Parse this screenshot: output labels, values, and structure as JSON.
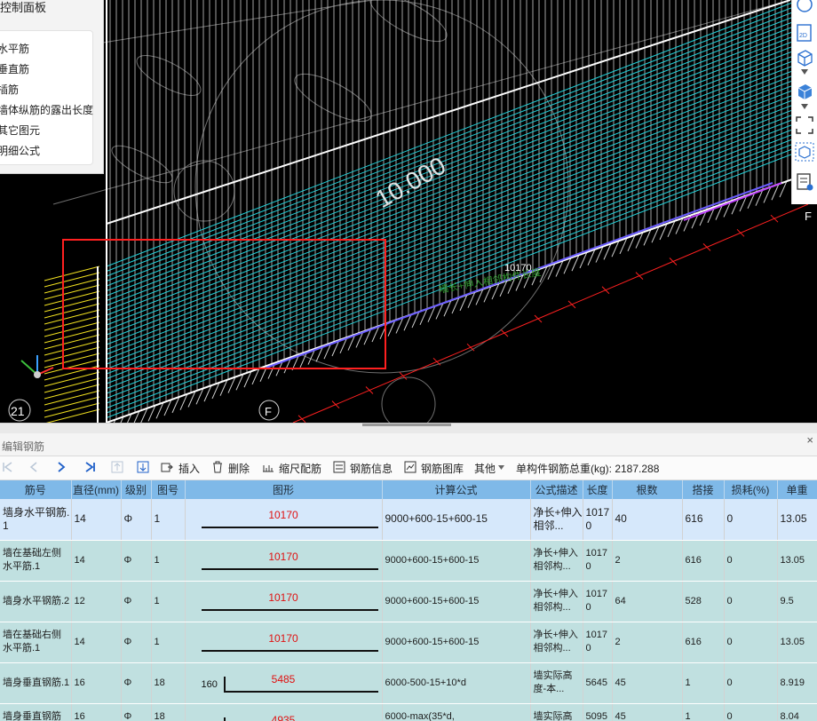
{
  "control_panel": {
    "title": "控制面板",
    "items": [
      "水平筋",
      "垂直筋",
      "插筋",
      "墙体纵筋的露出长度",
      "其它图元",
      "明细公式"
    ]
  },
  "viewport": {
    "elevation_text": "10.000",
    "dimension_text": "10170",
    "overlay_text": "墙长+伸入相邻构件长度",
    "axis_labels": [
      "21",
      "F",
      "F"
    ],
    "colors": {
      "background": "#000000",
      "rebar": "#22d0d8",
      "grid": "#ffffff",
      "selection": "#ff2020",
      "dimension": "#ff2020",
      "mesh": "#f0e020"
    }
  },
  "right_toolbar": [
    "circle-icon",
    "2d-view-icon",
    "cube-icon",
    "solid-cube-icon",
    "fullscreen-icon",
    "3d-box-icon",
    "view-settings-icon"
  ],
  "panel": {
    "title": "编辑钢筋",
    "close": "×"
  },
  "toolbar": {
    "insert": "插入",
    "delete": "删除",
    "scale": "缩尺配筋",
    "info": "钢筋信息",
    "library": "钢筋图库",
    "other": "其他",
    "total_label": "单构件钢筋总重(kg): 2187.288"
  },
  "table": {
    "headers": [
      "筋号",
      "直径(mm)",
      "级别",
      "图号",
      "图形",
      "计算公式",
      "公式描述",
      "长度",
      "根数",
      "搭接",
      "损耗(%)",
      "单重"
    ],
    "rows": [
      {
        "name": "墙身水平钢筋.1",
        "diameter": "14",
        "grade": "Φ",
        "fig": "1",
        "side": "",
        "shape_num": "10170",
        "formula": "9000+600-15+600-15",
        "desc": "净长+伸入相邻...",
        "length": "10170",
        "count": "40",
        "lap": "616",
        "loss": "0",
        "unit": "13.05"
      },
      {
        "name": "墙在基础左侧水平筋.1",
        "diameter": "14",
        "grade": "Φ",
        "fig": "1",
        "side": "",
        "shape_num": "10170",
        "formula": "9000+600-15+600-15",
        "desc": "净长+伸入相邻构...",
        "length": "10170",
        "count": "2",
        "lap": "616",
        "loss": "0",
        "unit": "13.05"
      },
      {
        "name": "墙身水平钢筋.2",
        "diameter": "12",
        "grade": "Φ",
        "fig": "1",
        "side": "",
        "shape_num": "10170",
        "formula": "9000+600-15+600-15",
        "desc": "净长+伸入相邻构...",
        "length": "10170",
        "count": "64",
        "lap": "528",
        "loss": "0",
        "unit": "9.5"
      },
      {
        "name": "墙在基础右侧水平筋.1",
        "diameter": "14",
        "grade": "Φ",
        "fig": "1",
        "side": "",
        "shape_num": "10170",
        "formula": "9000+600-15+600-15",
        "desc": "净长+伸入相邻构...",
        "length": "10170",
        "count": "2",
        "lap": "616",
        "loss": "0",
        "unit": "13.05"
      },
      {
        "name": "墙身垂直钢筋.1",
        "diameter": "16",
        "grade": "Φ",
        "fig": "18",
        "side": "160",
        "shape_num": "5485",
        "formula": "6000-500-15+10*d",
        "desc": "墙实际高度-本...",
        "length": "5645",
        "count": "45",
        "lap": "1",
        "loss": "0",
        "unit": "8.919"
      },
      {
        "name": "墙身垂直钢筋",
        "diameter": "16",
        "grade": "Φ",
        "fig": "18",
        "side": "",
        "shape_num": "4935",
        "formula": "6000-max(35*d,",
        "desc": "墙实际高",
        "length": "5095",
        "count": "45",
        "lap": "1",
        "loss": "0",
        "unit": "8.04"
      }
    ]
  }
}
